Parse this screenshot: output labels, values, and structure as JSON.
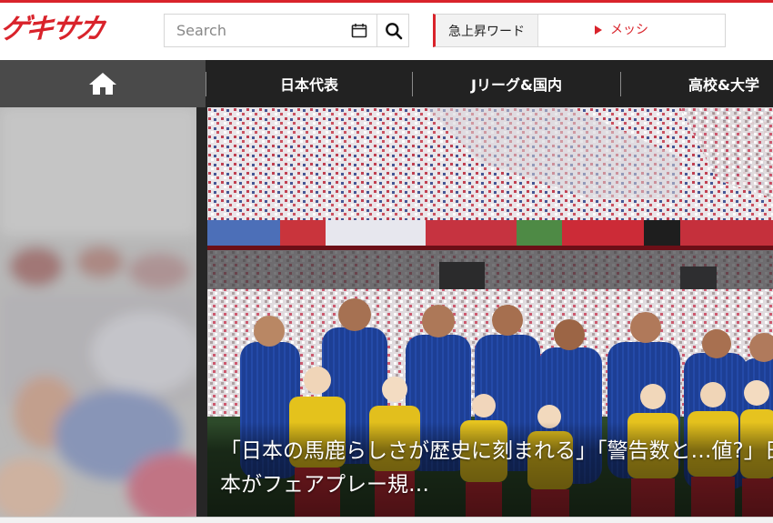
{
  "header": {
    "logo_text": "ゲキサカ",
    "search": {
      "placeholder": "Search",
      "value": ""
    },
    "trending": {
      "label": "急上昇ワード",
      "link_text": "メッシ"
    }
  },
  "nav": {
    "home_icon": "home-icon",
    "items": [
      {
        "label": "日本代表"
      },
      {
        "label": "Jリーグ&国内"
      },
      {
        "label": "高校&大学"
      }
    ]
  },
  "carousel": {
    "headline": "「日本の馬鹿らしさが歴史に刻まれる」「警告数と…値?」日本がフェアプレー規…"
  },
  "colors": {
    "brand_red": "#d9232b",
    "nav_bg": "#222222",
    "nav_home_bg": "#4a4a4a",
    "kit_blue": "#1d3f95",
    "kid_shirt_yellow": "#e4c21c"
  }
}
